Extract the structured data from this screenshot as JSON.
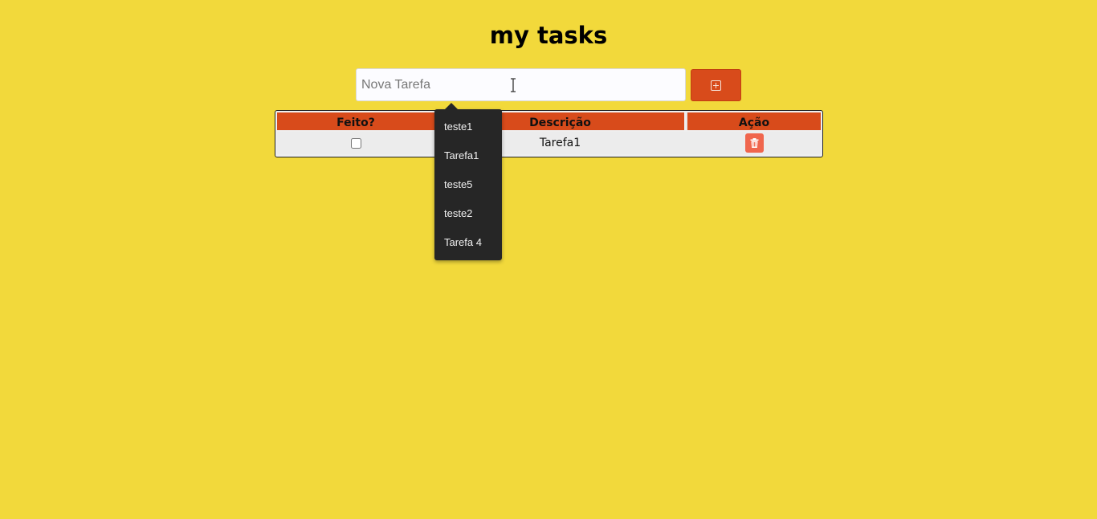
{
  "header": {
    "title": "my tasks"
  },
  "new_task": {
    "placeholder": "Nova Tarefa",
    "value": "",
    "add_button_icon": "plus-square-icon"
  },
  "table": {
    "columns": [
      "Feito?",
      "Descrição",
      "Ação"
    ],
    "rows": [
      {
        "done": false,
        "description": "Tarefa1",
        "action_icon": "trash-icon"
      }
    ]
  },
  "autocomplete": {
    "options": [
      "teste1",
      "Tarefa1",
      "teste5",
      "teste2",
      "Tarefa 4"
    ]
  },
  "colors": {
    "background": "#f2d93b",
    "accent": "#d84b1b",
    "delete": "#f0664d",
    "dropdown": "#262626"
  }
}
